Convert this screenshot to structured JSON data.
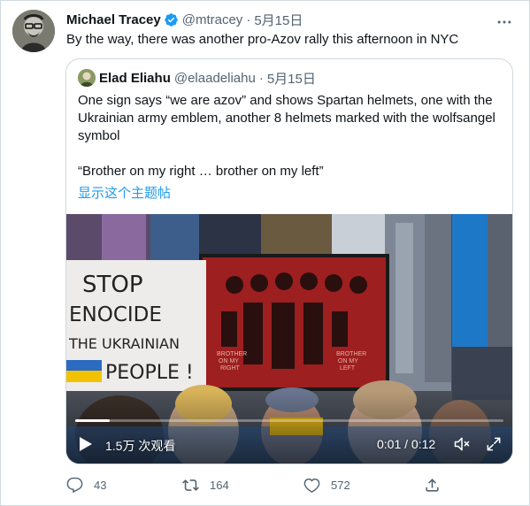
{
  "tweet": {
    "author_name": "Michael Tracey",
    "author_handle": "@mtracey",
    "separator": "·",
    "date": "5月15日",
    "text": "By the way, there was another pro-Azov rally this afternoon in NYC",
    "verified": true
  },
  "quoted": {
    "author_name": "Elad Eliahu",
    "author_handle": "@elaadeliahu",
    "separator": "·",
    "date": "5月15日",
    "paragraph1": "One sign says “we are azov” and shows Spartan helmets, one with the Ukrainian army emblem, another 8 helmets marked with the wolfsangel symbol",
    "paragraph2": "“Brother on my right … brother on my left”",
    "show_thread": "显示这个主题帖",
    "link_color": "#1d9bf0"
  },
  "video": {
    "views": "1.5万 次观看",
    "time": "0:01 / 0:12",
    "progress": 0.08,
    "sign_left_lines": [
      "STOP",
      "ENOCIDE",
      "THE UKRAINIAN",
      "PEOPLE !"
    ],
    "sign_right_left_lines": [
      "BROTHER",
      "ON MY",
      "RIGHT"
    ],
    "sign_right_right_lines": [
      "BROTHER",
      "ON MY",
      "LEFT"
    ]
  },
  "actions": {
    "reply_count": "43",
    "retweet_count": "164",
    "like_count": "572"
  }
}
